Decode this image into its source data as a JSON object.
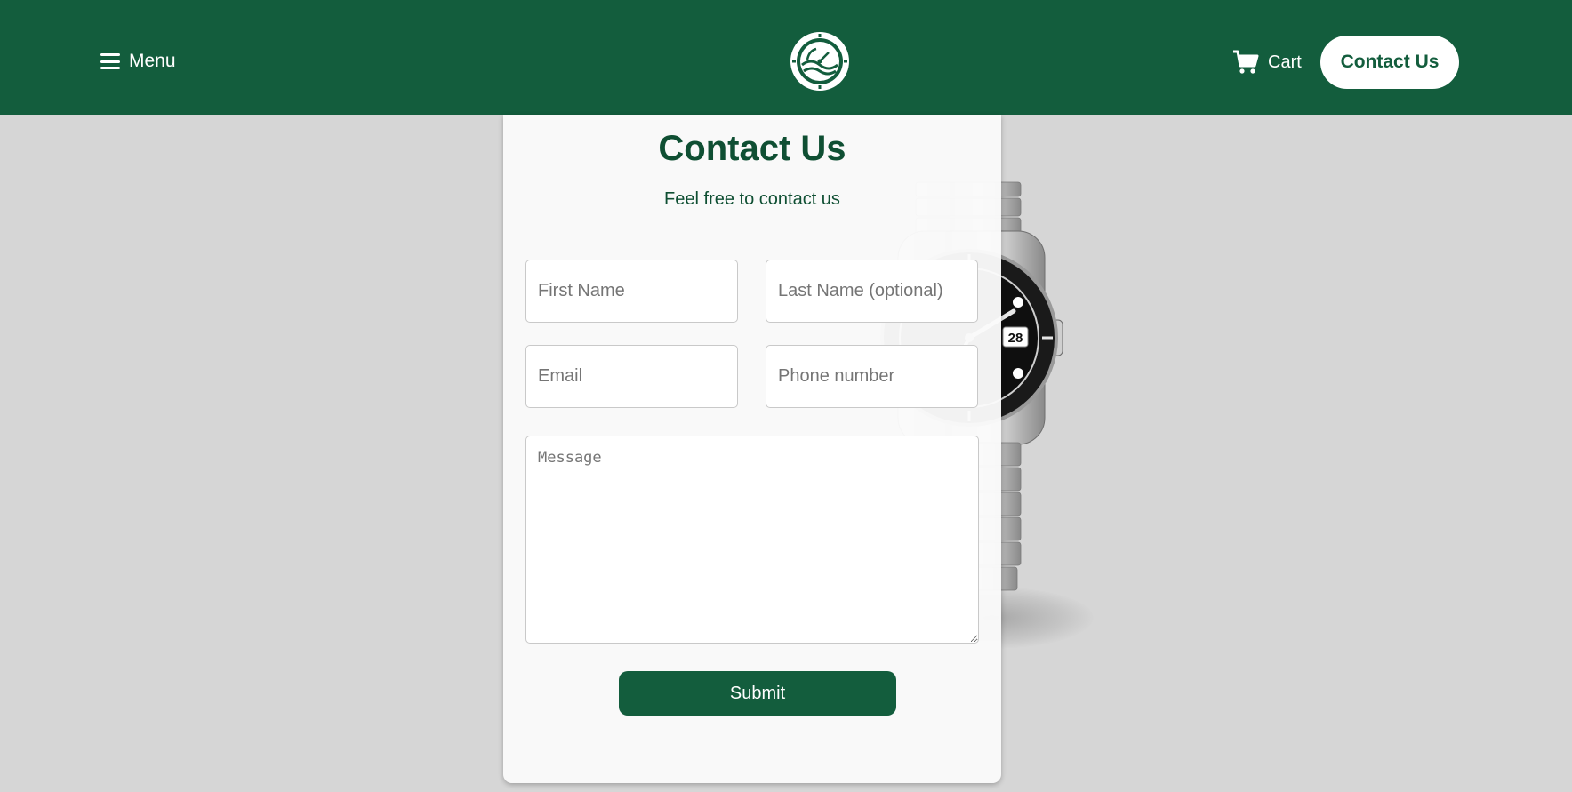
{
  "header": {
    "menu_label": "Menu",
    "cart_label": "Cart",
    "contact_label": "Contact Us",
    "logo_icon": "watch-wave-logo-icon"
  },
  "form": {
    "title": "Contact Us",
    "subtitle": "Feel free to contact us",
    "first_name_placeholder": "First Name",
    "last_name_placeholder": "Last Name (optional)",
    "email_placeholder": "Email",
    "phone_placeholder": "Phone number",
    "message_placeholder": "Message",
    "submit_label": "Submit"
  },
  "watch_image": {
    "icon": "wristwatch-image",
    "date_window": "28"
  },
  "colors": {
    "brand": "#135d3d",
    "background": "#d6d6d6",
    "card": "#fafafa"
  }
}
